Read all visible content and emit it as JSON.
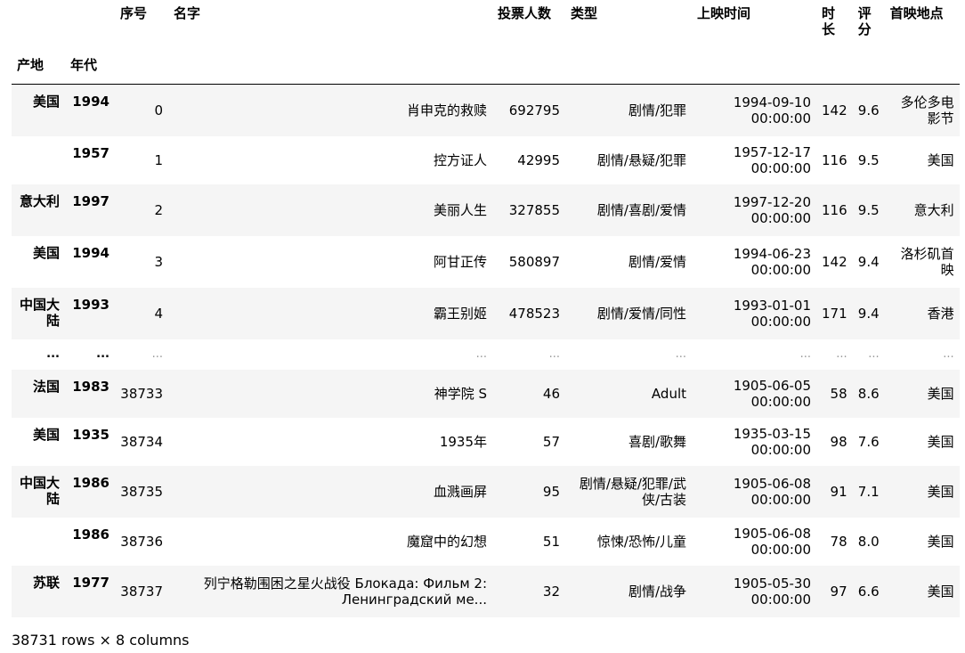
{
  "header": {
    "columns": [
      "序号",
      "名字",
      "投票人数",
      "类型",
      "上映时间",
      "时长",
      "评分",
      "首映地点"
    ],
    "index_names": [
      "产地",
      "年代"
    ]
  },
  "rows": [
    {
      "country": "美国",
      "year": "1994",
      "cells": [
        "0",
        "肖申克的救赎",
        "692795",
        "剧情/犯罪",
        "1994-09-10 00:00:00",
        "142",
        "9.6",
        "多伦多电影节"
      ]
    },
    {
      "country": "",
      "year": "1957",
      "cells": [
        "1",
        "控方证人",
        "42995",
        "剧情/悬疑/犯罪",
        "1957-12-17 00:00:00",
        "116",
        "9.5",
        "美国"
      ]
    },
    {
      "country": "意大利",
      "year": "1997",
      "cells": [
        "2",
        "美丽人生",
        "327855",
        "剧情/喜剧/爱情",
        "1997-12-20 00:00:00",
        "116",
        "9.5",
        "意大利"
      ]
    },
    {
      "country": "美国",
      "year": "1994",
      "cells": [
        "3",
        "阿甘正传",
        "580897",
        "剧情/爱情",
        "1994-06-23 00:00:00",
        "142",
        "9.4",
        "洛杉矶首映"
      ]
    },
    {
      "country": "中国大陆",
      "year": "1993",
      "cells": [
        "4",
        "霸王别姬",
        "478523",
        "剧情/爱情/同性",
        "1993-01-01 00:00:00",
        "171",
        "9.4",
        "香港"
      ]
    },
    {
      "country": "...",
      "year": "...",
      "cells": [
        "...",
        "...",
        "...",
        "...",
        "...",
        "...",
        "...",
        "..."
      ]
    },
    {
      "country": "法国",
      "year": "1983",
      "cells": [
        "38733",
        "神学院 S",
        "46",
        "Adult",
        "1905-06-05 00:00:00",
        "58",
        "8.6",
        "美国"
      ]
    },
    {
      "country": "美国",
      "year": "1935",
      "cells": [
        "38734",
        "1935年",
        "57",
        "喜剧/歌舞",
        "1935-03-15 00:00:00",
        "98",
        "7.6",
        "美国"
      ]
    },
    {
      "country": "中国大陆",
      "year": "1986",
      "cells": [
        "38735",
        "血溅画屏",
        "95",
        "剧情/悬疑/犯罪/武侠/古装",
        "1905-06-08 00:00:00",
        "91",
        "7.1",
        "美国"
      ]
    },
    {
      "country": "",
      "year": "1986",
      "cells": [
        "38736",
        "魔窟中的幻想",
        "51",
        "惊悚/恐怖/儿童",
        "1905-06-08 00:00:00",
        "78",
        "8.0",
        "美国"
      ]
    },
    {
      "country": "苏联",
      "year": "1977",
      "cells": [
        "38737",
        "列宁格勒围困之星火战役 Блокада: Фильм 2: Ленинградский ме...",
        "32",
        "剧情/战争",
        "1905-05-30 00:00:00",
        "97",
        "6.6",
        "美国"
      ]
    }
  ],
  "footer": "38731 rows × 8 columns"
}
